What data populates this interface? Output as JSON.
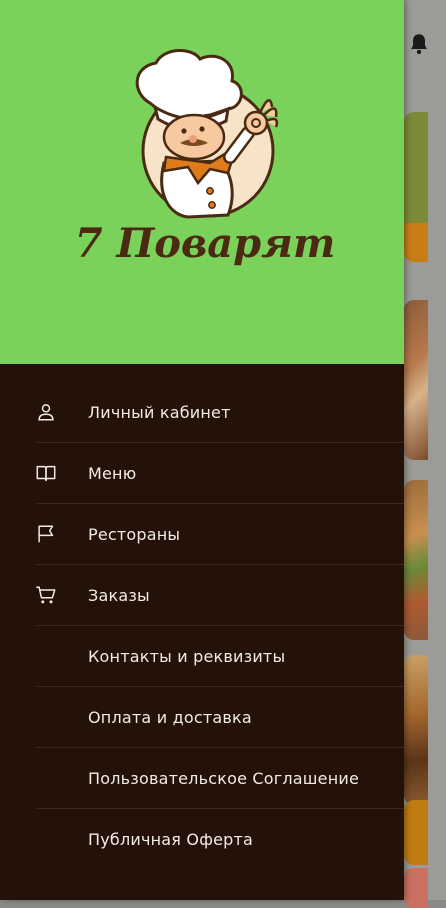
{
  "app": {
    "brand": "7 Поварят"
  },
  "menu": {
    "items": [
      {
        "label": "Личный кабинет",
        "icon": "user-icon"
      },
      {
        "label": "Меню",
        "icon": "book-icon"
      },
      {
        "label": "Рестораны",
        "icon": "flag-icon"
      },
      {
        "label": "Заказы",
        "icon": "cart-icon"
      },
      {
        "label": "Контакты и реквизиты",
        "icon": ""
      },
      {
        "label": "Оплата и доставка",
        "icon": ""
      },
      {
        "label": "Пользовательское Соглашение",
        "icon": ""
      },
      {
        "label": "Публичная Оферта",
        "icon": ""
      }
    ]
  },
  "colors": {
    "header_green": "#7ad25a",
    "drawer_background": "#241209",
    "menu_text": "#f2ece6",
    "brand_text": "#4a2a12",
    "accent_orange": "#e07b1a"
  }
}
